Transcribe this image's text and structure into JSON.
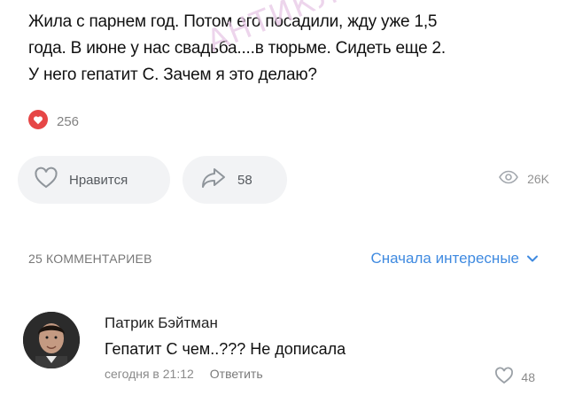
{
  "post": {
    "text_lines": [
      "Жила с парнем год. Потом его посадили, жду уже 1,5",
      "года. В июне у нас свадьба....в тюрьме. Сидеть еще 2.",
      "У него гепатит С. Зачем я это делаю?"
    ],
    "watermark": "АНТИКЛУБ",
    "reaction_count": "256"
  },
  "actions": {
    "like_label": "Нравится",
    "share_count": "58",
    "views_count": "26K"
  },
  "comments": {
    "count_label": "25 КОММЕНТАРИЕВ",
    "sort_label": "Сначала интересные",
    "items": [
      {
        "author": "Патрик Бэйтман",
        "text": "Гепатит С чем..??? Не дописала",
        "time": "сегодня в 21:12",
        "reply_label": "Ответить",
        "likes": "48"
      }
    ]
  },
  "colors": {
    "accent": "#3f8ae0",
    "reaction_red": "#e64646",
    "pill_bg": "#f2f3f5"
  }
}
